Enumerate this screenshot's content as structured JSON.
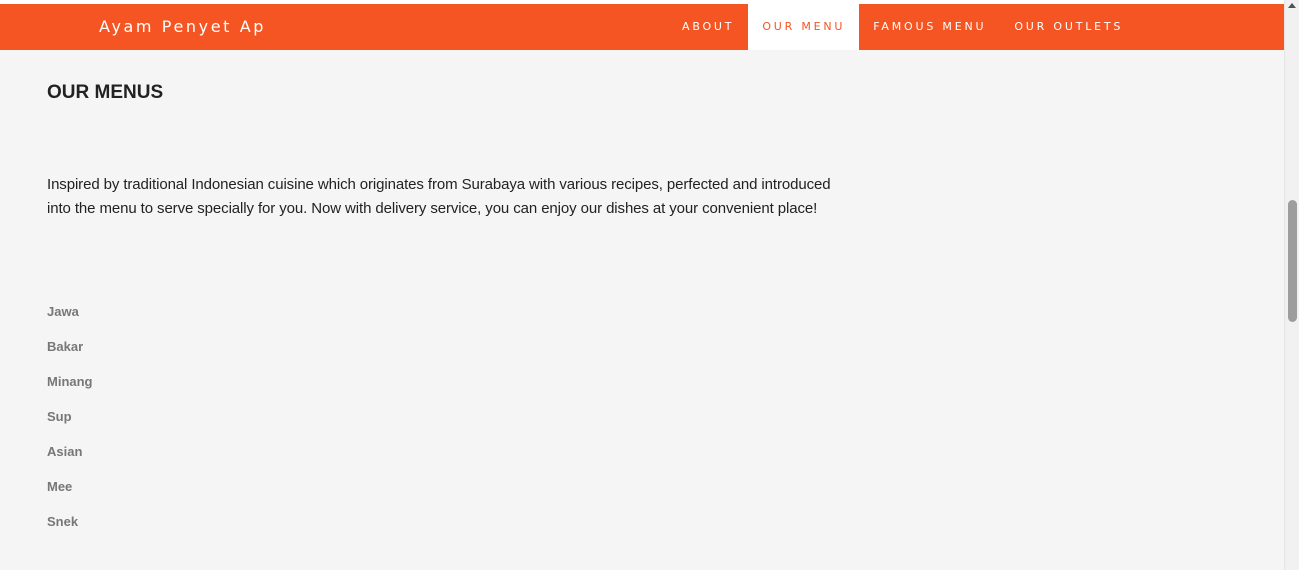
{
  "header": {
    "brand": "Ayam Penyet Ap",
    "nav": [
      {
        "label": "ABOUT",
        "active": false
      },
      {
        "label": "OUR MENU",
        "active": true
      },
      {
        "label": "FAMOUS MENU",
        "active": false
      },
      {
        "label": "OUR OUTLETS",
        "active": false
      }
    ]
  },
  "main": {
    "title": "OUR MENUS",
    "intro": "Inspired by traditional Indonesian cuisine which originates from Surabaya with various recipes, perfected and introduced into the menu to serve specially for you. Now with delivery service, you can enjoy our dishes at your convenient place!",
    "categories": [
      "Jawa",
      "Bakar",
      "Minang",
      "Sup",
      "Asian",
      "Mee",
      "Snek"
    ]
  },
  "colors": {
    "accent": "#f55522",
    "background": "#f5f5f5",
    "text": "#222222",
    "muted": "#777777"
  }
}
